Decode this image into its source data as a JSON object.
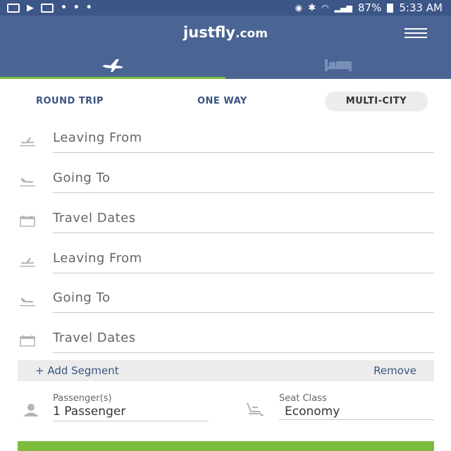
{
  "status_bar": {
    "battery": "87%",
    "time": "5:33 AM",
    "more": "• • •"
  },
  "header": {
    "logo_main": "justfly",
    "logo_domain": ".com",
    "tabs": [
      {
        "name": "flights",
        "icon": "airplane-icon",
        "active": true
      },
      {
        "name": "hotels",
        "icon": "bed-icon",
        "active": false
      }
    ]
  },
  "trip_types": {
    "round_trip": "ROUND TRIP",
    "one_way": "ONE WAY",
    "multi_city": "MULTI-CITY",
    "selected": "MULTI-CITY"
  },
  "fields": [
    {
      "label": "Leaving From",
      "icon": "departure-icon"
    },
    {
      "label": "Going To",
      "icon": "arrival-icon"
    },
    {
      "label": "Travel Dates",
      "icon": "calendar-icon"
    },
    {
      "label": "Leaving From",
      "icon": "departure-icon"
    },
    {
      "label": "Going To",
      "icon": "arrival-icon"
    },
    {
      "label": "Travel Dates",
      "icon": "calendar-icon"
    }
  ],
  "segment": {
    "add_label": "+ Add Segment",
    "remove_label": "Remove"
  },
  "passengers": {
    "label": "Passenger(s)",
    "value": "1 Passenger",
    "icon": "person-icon"
  },
  "seat_class": {
    "label": "Seat Class",
    "value": "Economy",
    "icon": "seat-icon"
  },
  "colors": {
    "header": "#4a6494",
    "status_bar": "#3b5687",
    "accent_green": "#7dbb3f",
    "link_blue": "#3a5582"
  }
}
